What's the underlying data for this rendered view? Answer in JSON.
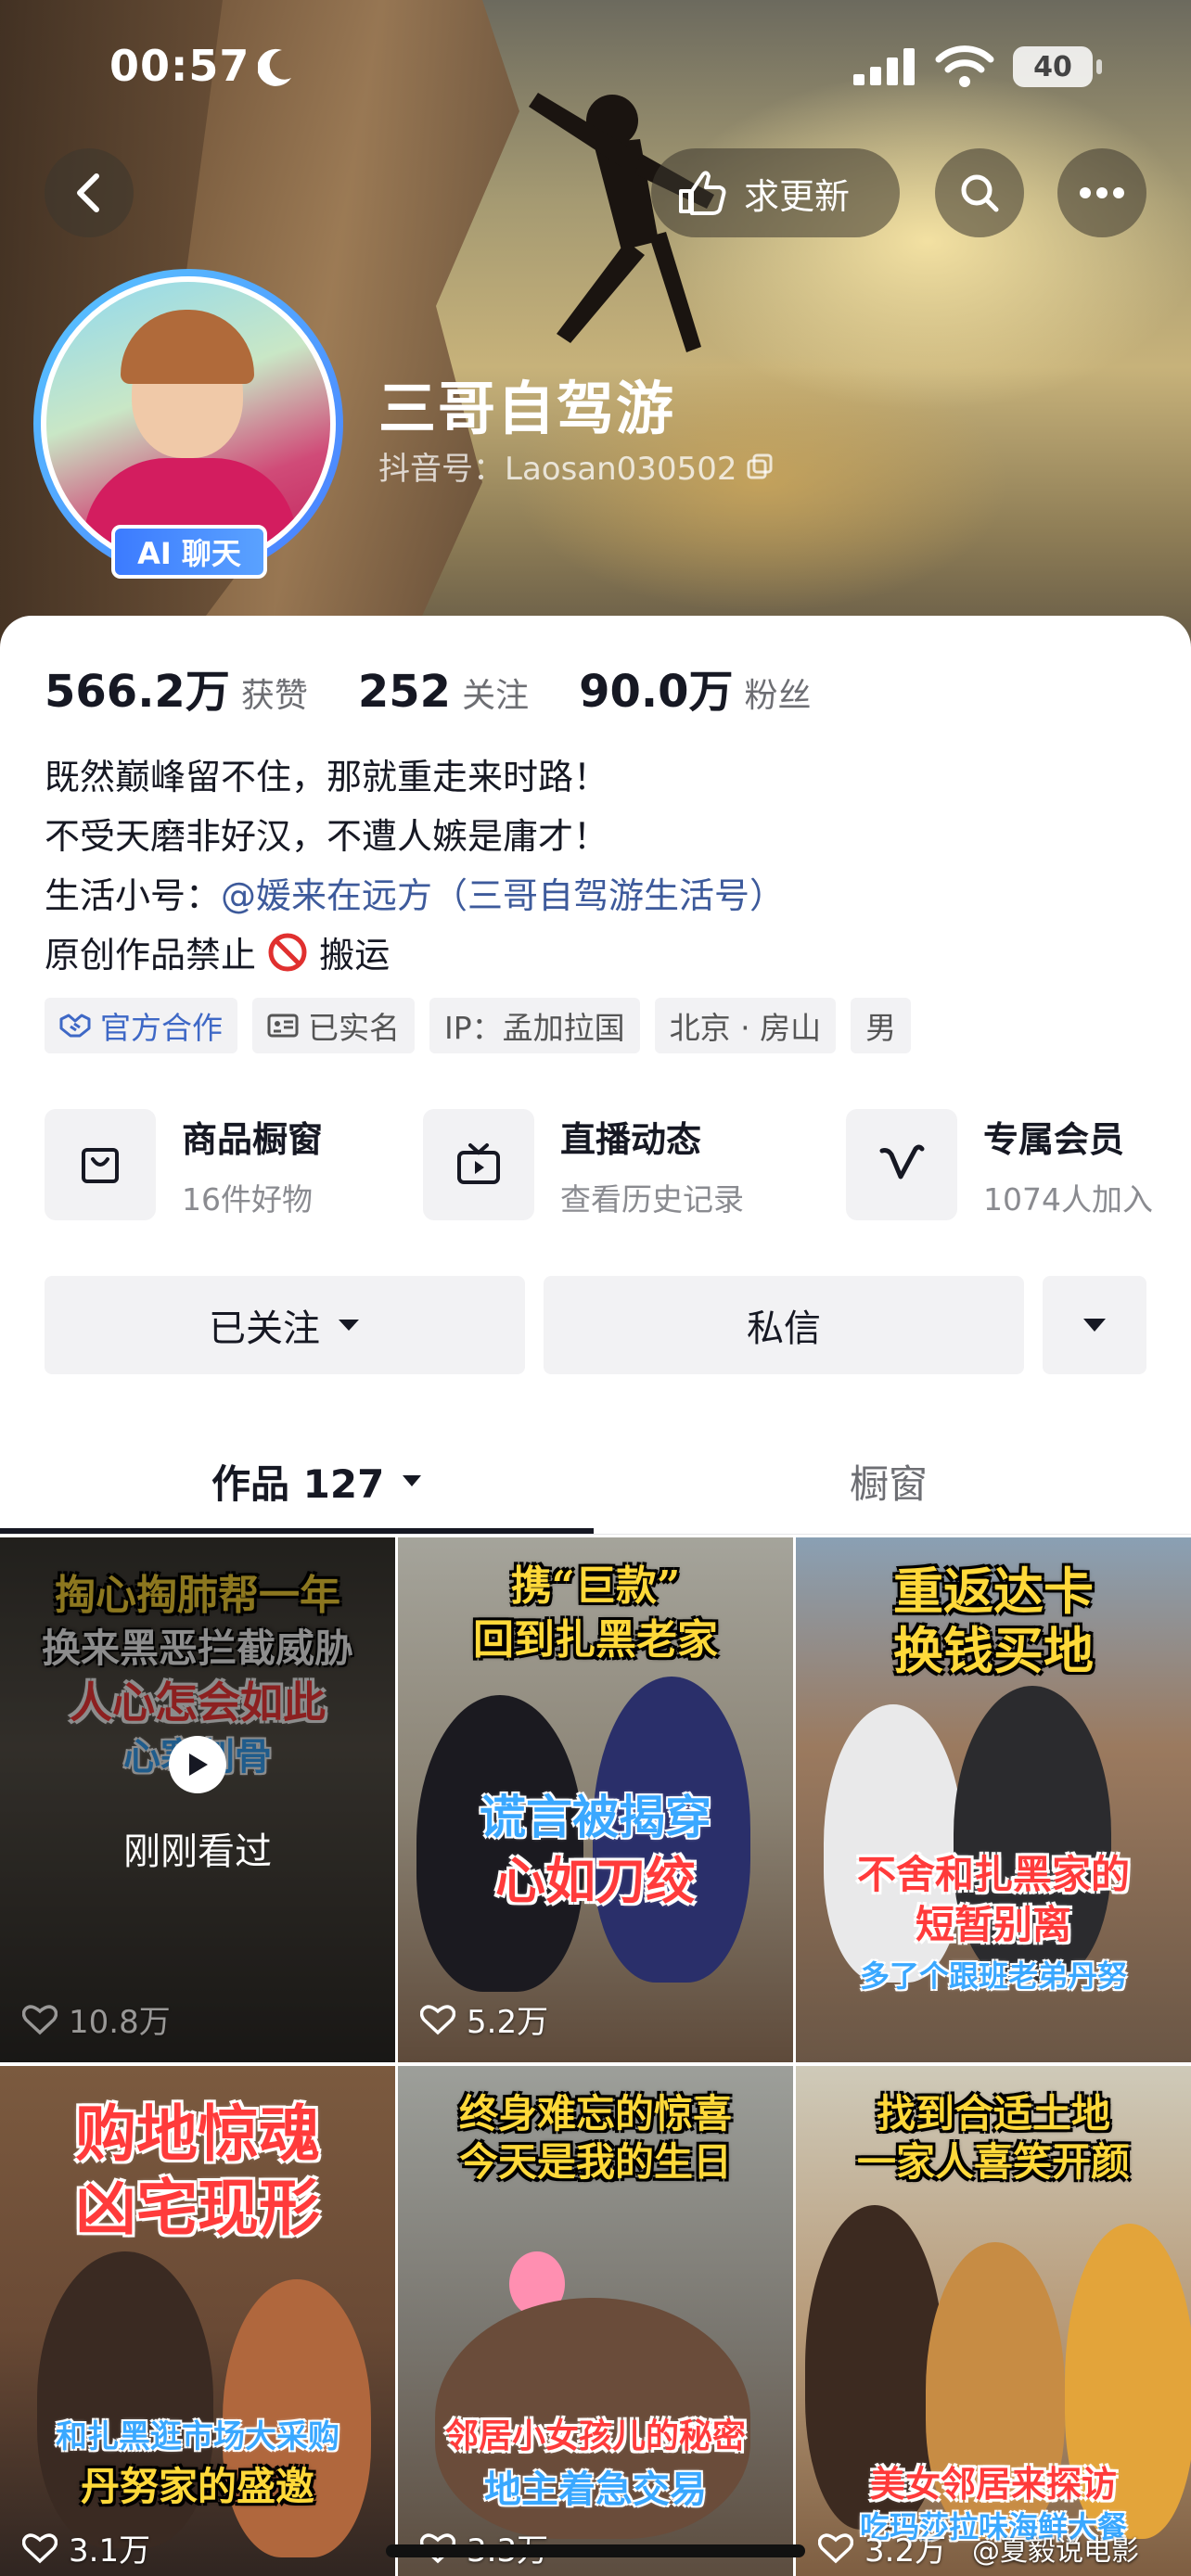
{
  "status_bar": {
    "time": "00:57",
    "battery": "40"
  },
  "header": {
    "update_label": "求更新"
  },
  "profile": {
    "ai_badge": "AI 聊天",
    "nickname": "三哥自驾游",
    "douyin_id": "抖音号：Laosan030502"
  },
  "stats": [
    {
      "value": "566.2万",
      "label": "获赞"
    },
    {
      "value": "252",
      "label": "关注"
    },
    {
      "value": "90.0万",
      "label": "粉丝"
    }
  ],
  "bio": {
    "line1": "既然巅峰留不住，那就重走来时路！",
    "line2": "不受天磨非好汉，不遭人嫉是庸才！",
    "line3_prefix": "生活小号：",
    "line3_link": "@媛来在远方（三哥自驾游生活号）",
    "line4_before": "原创作品禁止",
    "line4_after": "搬运"
  },
  "tags": [
    {
      "label": "官方合作",
      "icon": "handshake-icon"
    },
    {
      "label": "已实名",
      "icon": "id-card-icon"
    },
    {
      "label": "IP：孟加拉国"
    },
    {
      "label": "北京 · 房山"
    },
    {
      "label": "男"
    }
  ],
  "services": [
    {
      "title": "商品橱窗",
      "subtitle": "16件好物",
      "icon": "shopping-bag-icon"
    },
    {
      "title": "直播动态",
      "subtitle": "查看历史记录",
      "icon": "tv-icon"
    },
    {
      "title": "专属会员",
      "subtitle": "1074人加入",
      "icon": "vip-v-icon"
    }
  ],
  "actions": {
    "followed": "已关注",
    "message": "私信"
  },
  "tabs": {
    "works": "作品 127",
    "showcase": "橱窗"
  },
  "videos": [
    {
      "cap1": "掏心掏肺帮一年",
      "cap2": "换来黑恶拦截威胁",
      "cap3": "人心怎会如此",
      "cap4": "心寒刺骨",
      "likes": "10.8万",
      "watched": "刚刚看过"
    },
    {
      "cap1": "携“巨款”",
      "cap2": "回到扎黑老家",
      "cap3": "谎言被揭穿",
      "cap4": "心如刀绞",
      "likes": "5.2万"
    },
    {
      "cap1": "重返达卡",
      "cap2": "换钱买地",
      "cap3": "不舍和扎黑家的",
      "cap4": "短暂别离",
      "cap5": "多了个跟班老弟丹努",
      "likes": ""
    },
    {
      "cap1": "购地惊魂",
      "cap2": "凶宅现形",
      "cap3": "和扎黑逛市场大采购",
      "cap4": "丹努家的盛邀",
      "likes": "3.1万"
    },
    {
      "cap1": "终身难忘的惊喜",
      "cap2": "今天是我的生日",
      "cap3": "邻居小女孩儿的秘密",
      "cap4": "地主着急交易",
      "likes": "3.3万"
    },
    {
      "cap1": "找到合适土地",
      "cap2": "一家人喜笑开颜",
      "cap3": "美女邻居来探访",
      "cap4": "吃玛莎拉味海鲜大餐",
      "likes": "3.2万"
    }
  ],
  "watermark": "@夏毅说电影",
  "colors": {
    "link": "#3d5a9b",
    "official_tag": "#3e68c6",
    "ai_badge": "#3c7bff"
  }
}
